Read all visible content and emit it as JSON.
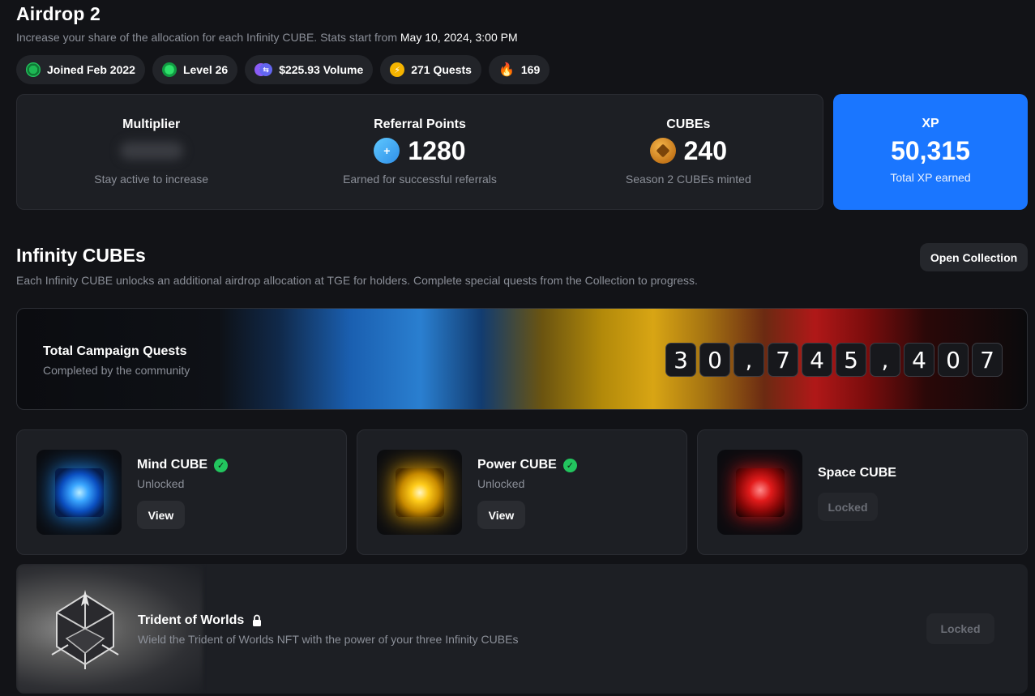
{
  "header": {
    "title": "Airdrop 2",
    "subtitle_prefix": "Increase your share of the allocation for each Infinity CUBE. Stats start from",
    "subtitle_date": "May 10, 2024, 3:00 PM"
  },
  "pills": {
    "joined": "Joined Feb 2022",
    "level": "Level 26",
    "volume": "$225.93 Volume",
    "quests": "271 Quests",
    "streak": "169"
  },
  "stats": {
    "multiplier": {
      "label": "Multiplier",
      "caption": "Stay active to increase"
    },
    "referral": {
      "label": "Referral Points",
      "value": "1280",
      "caption": "Earned for successful referrals"
    },
    "cubes": {
      "label": "CUBEs",
      "value": "240",
      "caption": "Season 2 CUBEs minted"
    },
    "xp": {
      "label": "XP",
      "value": "50,315",
      "caption": "Total XP earned"
    }
  },
  "infinity": {
    "title": "Infinity CUBEs",
    "subtitle": "Each Infinity CUBE unlocks an additional airdrop allocation at TGE for holders. Complete special quests from the Collection to progress.",
    "open_collection": "Open Collection"
  },
  "campaign": {
    "title": "Total Campaign Quests",
    "subtitle": "Completed by the community",
    "digits": [
      "3",
      "0",
      ",",
      "7",
      "4",
      "5",
      ",",
      "4",
      "0",
      "7"
    ]
  },
  "cubes": [
    {
      "name": "Mind CUBE",
      "status": "Unlocked",
      "action": "View"
    },
    {
      "name": "Power CUBE",
      "status": "Unlocked",
      "action": "View"
    },
    {
      "name": "Space CUBE",
      "action": "Locked"
    }
  ],
  "trident": {
    "title": "Trident of Worlds",
    "subtitle": "Wield the Trident of Worlds NFT with the power of your three Infinity CUBEs",
    "action": "Locked"
  },
  "colors": {
    "background": "#121317",
    "card": "#1d1f24",
    "xp_accent": "#1a76ff",
    "check": "#22c55e"
  }
}
